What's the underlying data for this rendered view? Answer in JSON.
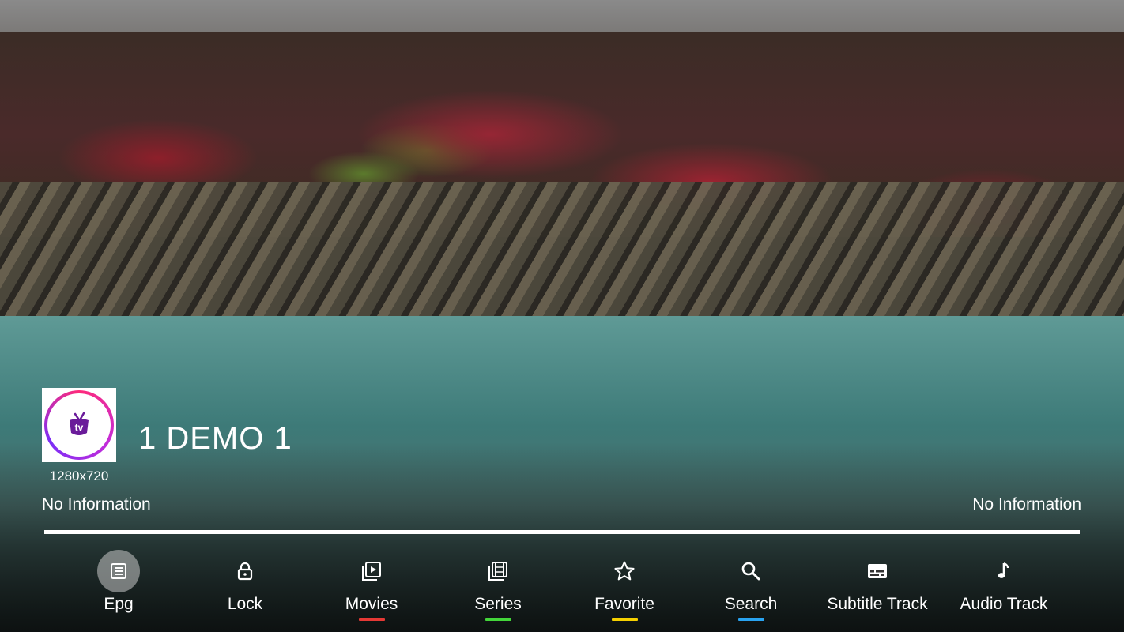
{
  "channel": {
    "title": "1 DEMO 1",
    "resolution": "1280x720",
    "logo_icon": "tv-logo-icon",
    "info_left": "No Information",
    "info_right": "No Information",
    "progress": 1.0
  },
  "menu": {
    "items": [
      {
        "label": "Epg",
        "icon": "epg-icon",
        "focused": true,
        "underline": ""
      },
      {
        "label": "Lock",
        "icon": "lock-icon",
        "focused": false,
        "underline": ""
      },
      {
        "label": "Movies",
        "icon": "movies-icon",
        "focused": false,
        "underline": "#e53935"
      },
      {
        "label": "Series",
        "icon": "series-icon",
        "focused": false,
        "underline": "#43d63a"
      },
      {
        "label": "Favorite",
        "icon": "star-icon",
        "focused": false,
        "underline": "#f5d000"
      },
      {
        "label": "Search",
        "icon": "search-icon",
        "focused": false,
        "underline": "#29a3f0"
      },
      {
        "label": "Subtitle Track",
        "icon": "subtitle-icon",
        "focused": false,
        "underline": ""
      },
      {
        "label": "Audio Track",
        "icon": "music-note-icon",
        "focused": false,
        "underline": ""
      }
    ]
  },
  "colors": {
    "logo_gradient_start": "#ff2a7a",
    "logo_gradient_end": "#7b2ff7",
    "logo_tv_purple": "#6a1b9a"
  }
}
